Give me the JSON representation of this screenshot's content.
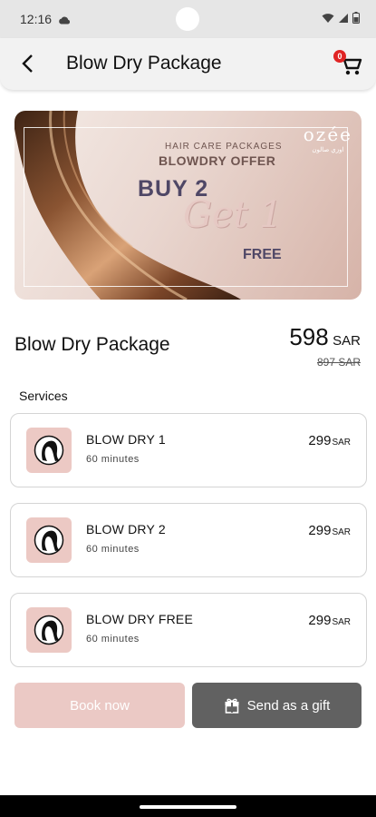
{
  "status_bar": {
    "time": "12:16"
  },
  "app_bar": {
    "title": "Blow Dry Package",
    "cart_count": "0"
  },
  "banner": {
    "subtitle": "HAIR CARE PACKAGES",
    "offer": "BLOWDRY OFFER",
    "buy": "BUY 2",
    "get": "Get 1",
    "free": "FREE",
    "logo": "ozée",
    "logo_sub": "اوزي صالون"
  },
  "package": {
    "title": "Blow Dry Package",
    "price": "598",
    "currency": "SAR",
    "old_price": "897 SAR"
  },
  "services_label": "Services",
  "services": [
    {
      "name": "BLOW DRY 1",
      "duration": "60 minutes",
      "price": "299",
      "currency": "SAR"
    },
    {
      "name": "BLOW DRY  2",
      "duration": "60 minutes",
      "price": "299",
      "currency": "SAR"
    },
    {
      "name": "BLOW DRY FREE",
      "duration": "60 minutes",
      "price": "299",
      "currency": "SAR"
    }
  ],
  "actions": {
    "book_label": "Book now",
    "gift_label": "Send as a gift"
  },
  "colors": {
    "accent": "#ebc9c5",
    "gift_button": "#616161",
    "badge": "#e02424"
  }
}
